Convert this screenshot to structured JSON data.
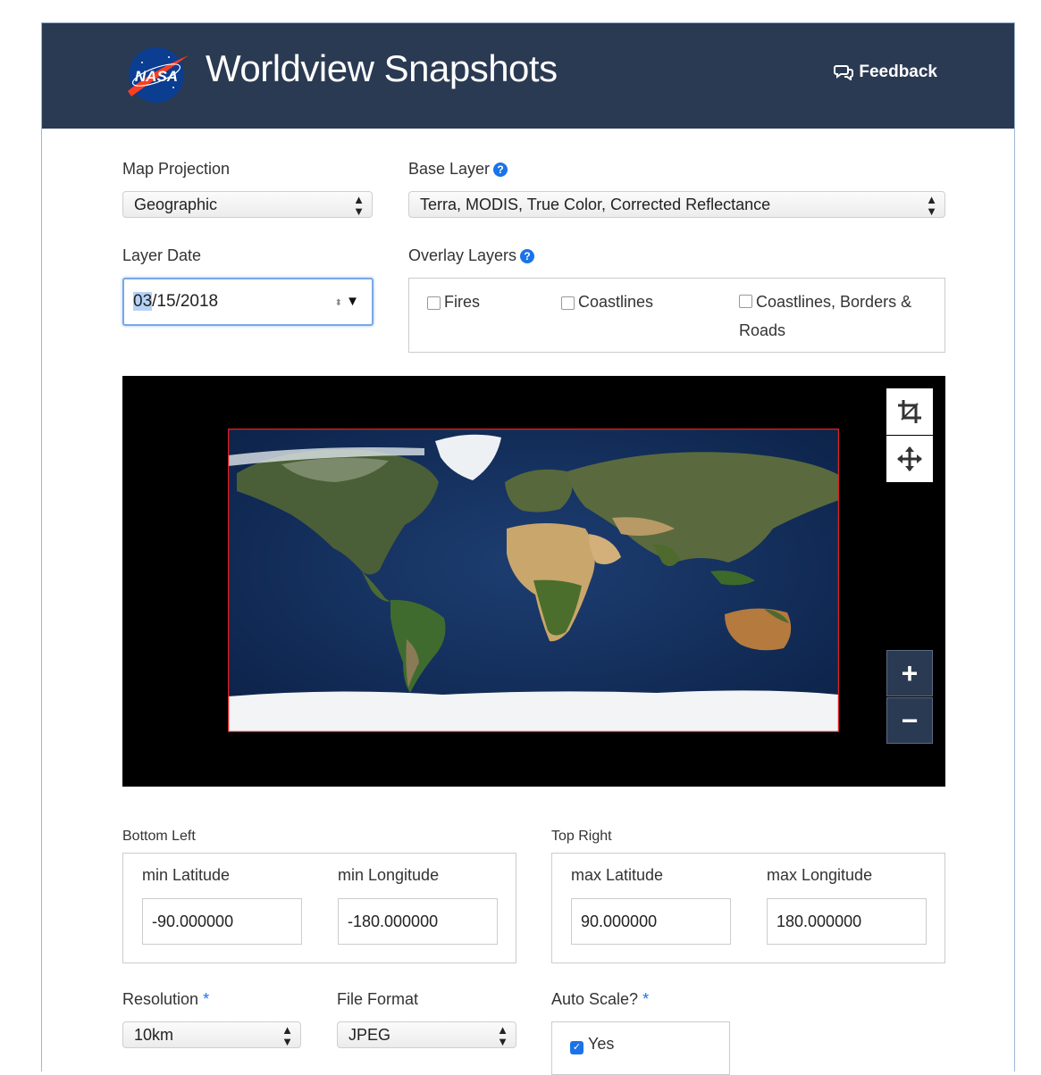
{
  "header": {
    "title": "Worldview Snapshots",
    "logo_text": "NASA",
    "feedback_label": "Feedback"
  },
  "form": {
    "map_projection": {
      "label": "Map Projection",
      "value": "Geographic"
    },
    "base_layer": {
      "label": "Base Layer",
      "value": "Terra, MODIS, True Color, Corrected Reflectance"
    },
    "layer_date": {
      "label": "Layer Date",
      "month": "03",
      "rest": "/15/2018"
    },
    "overlay_layers": {
      "label": "Overlay Layers",
      "items": [
        {
          "label": "Fires",
          "checked": false
        },
        {
          "label": "Coastlines",
          "checked": false
        },
        {
          "label": "Coastlines, Borders &",
          "label_line2": "Roads",
          "checked": false
        }
      ]
    }
  },
  "map": {
    "tools": [
      "crop-icon",
      "move-icon"
    ],
    "zoom_in": "+",
    "zoom_out": "−"
  },
  "bounds": {
    "bottom_left": {
      "label": "Bottom Left",
      "min_latitude_label": "min Latitude",
      "min_latitude": "-90.000000",
      "min_longitude_label": "min Longitude",
      "min_longitude": "-180.000000"
    },
    "top_right": {
      "label": "Top Right",
      "max_latitude_label": "max Latitude",
      "max_latitude": "90.000000",
      "max_longitude_label": "max Longitude",
      "max_longitude": "180.000000"
    }
  },
  "output": {
    "resolution": {
      "label": "Resolution",
      "required": "*",
      "value": "10km"
    },
    "file_format": {
      "label": "File Format",
      "value": "JPEG"
    },
    "auto_scale": {
      "label": "Auto Scale?",
      "required": "*",
      "option": "Yes",
      "checked": true
    }
  },
  "colors": {
    "header_bg": "#2a3a52",
    "accent": "#1a73e8",
    "bbox_border": "#e02020"
  }
}
